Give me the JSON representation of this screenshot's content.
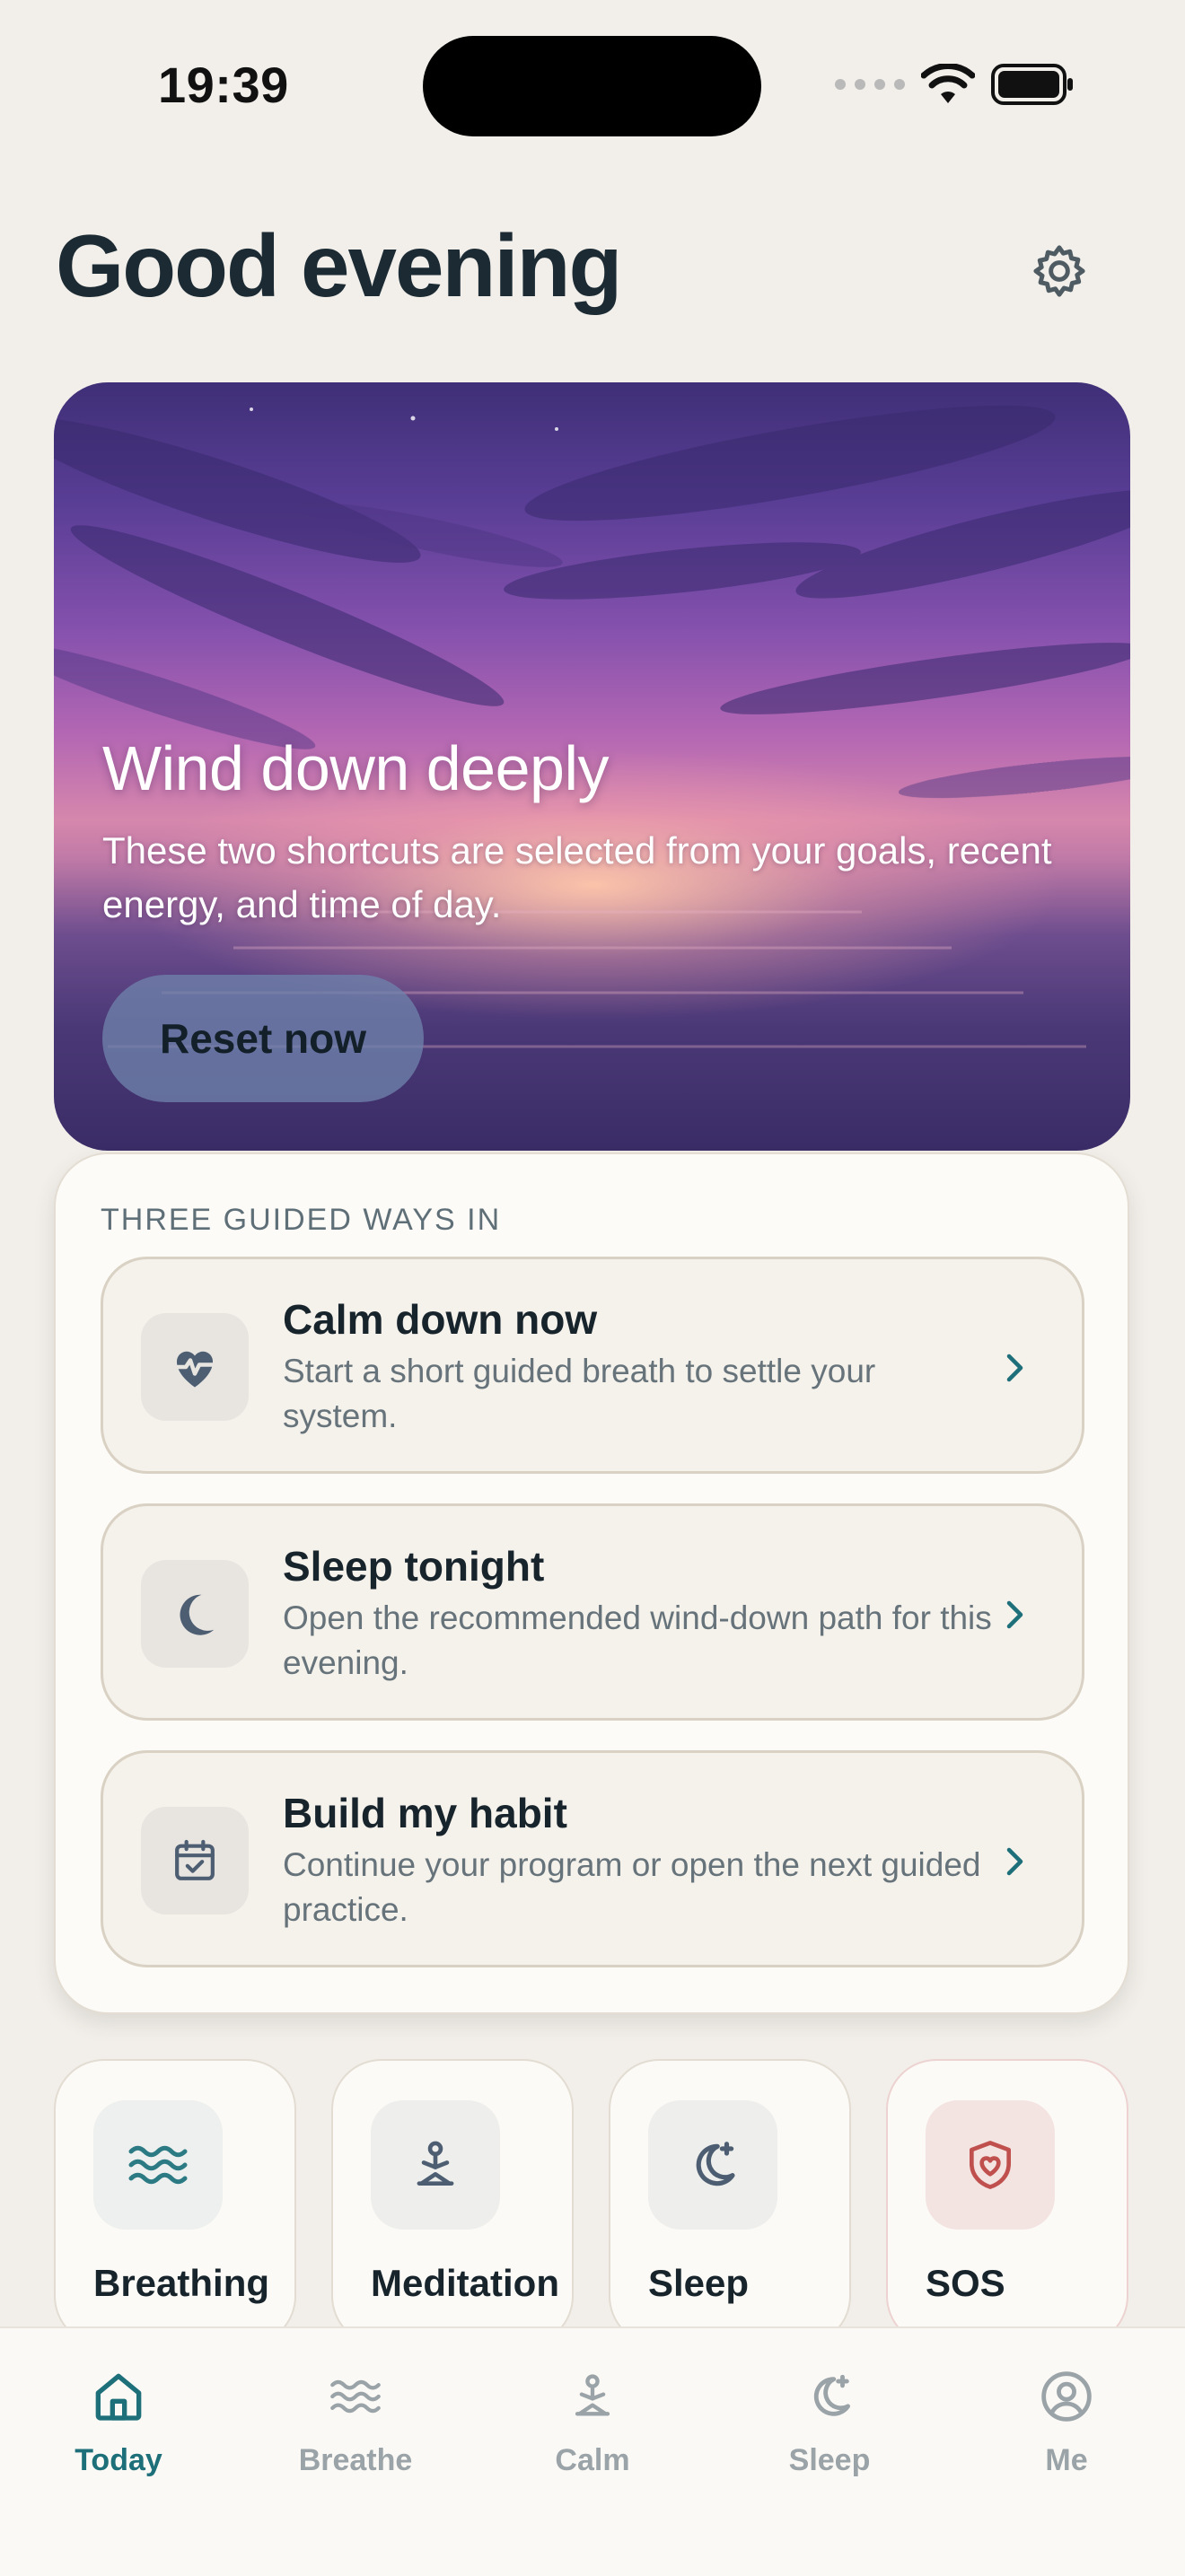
{
  "status_bar": {
    "time": "19:39"
  },
  "header": {
    "title": "Good evening",
    "settings_icon": "gear-icon"
  },
  "hero": {
    "title": "Wind down deeply",
    "subtitle": "These two shortcuts are selected from your goals, recent energy, and time of day.",
    "button_label": "Reset now"
  },
  "guided": {
    "section_label": "THREE GUIDED WAYS IN",
    "options": [
      {
        "title": "Calm down now",
        "description": "Start a short guided breath to settle your system.",
        "icon": "heart-pulse-icon"
      },
      {
        "title": "Sleep tonight",
        "description": "Open the recommended wind-down path for this evening.",
        "icon": "moon-icon"
      },
      {
        "title": "Build my habit",
        "description": "Continue your program or open the next guided practice.",
        "icon": "calendar-check-icon"
      }
    ]
  },
  "tiles": [
    {
      "label": "Breathing",
      "icon": "waves-icon"
    },
    {
      "label": "Meditation",
      "icon": "meditation-icon"
    },
    {
      "label": "Sleep",
      "icon": "moon-star-icon"
    },
    {
      "label": "SOS",
      "icon": "shield-heart-icon"
    }
  ],
  "tabbar": {
    "tabs": [
      {
        "label": "Today",
        "icon": "home-icon",
        "active": true
      },
      {
        "label": "Breathe",
        "icon": "waves-icon"
      },
      {
        "label": "Calm",
        "icon": "meditation-icon"
      },
      {
        "label": "Sleep",
        "icon": "moon-star-icon"
      },
      {
        "label": "Me",
        "icon": "profile-icon"
      }
    ]
  },
  "colors": {
    "accent": "#1d6f7a",
    "background": "#f2efea",
    "sos": "#c0504d"
  }
}
